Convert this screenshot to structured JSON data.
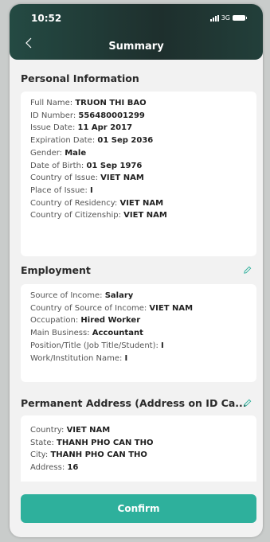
{
  "status_bar": {
    "time": "10:52",
    "network": "3G"
  },
  "header": {
    "title": "Summary"
  },
  "sections": {
    "personal": {
      "title": "Personal Information",
      "rows": [
        {
          "label": "Full Name:",
          "value": "TRUON THI BAO"
        },
        {
          "label": "ID Number:",
          "value": "556480001299"
        },
        {
          "label": "Issue Date:",
          "value": "11 Apr 2017"
        },
        {
          "label": "Expiration Date:",
          "value": "01 Sep 2036"
        },
        {
          "label": "Gender:",
          "value": "Male"
        },
        {
          "label": "Date of Birth:",
          "value": "01 Sep 1976"
        },
        {
          "label": "Country of Issue:",
          "value": "VIET NAM"
        },
        {
          "label": "Place of Issue:",
          "value": "I"
        },
        {
          "label": "Country of Residency:",
          "value": "VIET NAM"
        },
        {
          "label": "Country of Citizenship:",
          "value": "VIET NAM"
        }
      ]
    },
    "employment": {
      "title": "Employment",
      "rows": [
        {
          "label": "Source of Income:",
          "value": "Salary"
        },
        {
          "label": "Country of Source of Income:",
          "value": "VIET NAM"
        },
        {
          "label": "Occupation:",
          "value": "Hired Worker"
        },
        {
          "label": "Main Business:",
          "value": "Accountant"
        },
        {
          "label": "Position/Title (Job Title/Student):",
          "value": "I"
        },
        {
          "label": "Work/Institution Name:",
          "value": "I"
        }
      ]
    },
    "address": {
      "title": "Permanent Address (Address on ID Ca...",
      "rows": [
        {
          "label": "Country:",
          "value": "VIET NAM"
        },
        {
          "label": "State:",
          "value": "THANH PHO CAN THO"
        },
        {
          "label": "City:",
          "value": "THANH PHO CAN THO"
        },
        {
          "label": "Address:",
          "value": "16"
        }
      ]
    }
  },
  "confirm_label": "Confirm",
  "colors": {
    "accent": "#2eb09c",
    "header": "#1e2f2d"
  }
}
